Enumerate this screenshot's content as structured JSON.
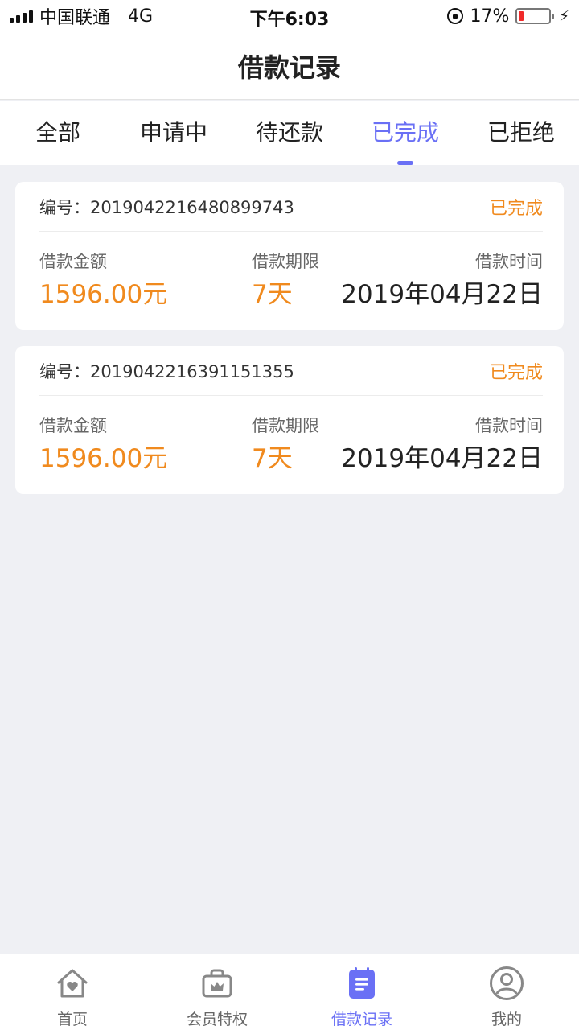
{
  "status_bar": {
    "carrier": "中国联通",
    "network": "4G",
    "time": "下午6:03",
    "battery": "17%",
    "battery_level": 0.17
  },
  "nav": {
    "title": "借款记录"
  },
  "tabs": [
    {
      "label": "全部"
    },
    {
      "label": "申请中"
    },
    {
      "label": "待还款"
    },
    {
      "label": "已完成"
    },
    {
      "label": "已拒绝"
    }
  ],
  "active_tab": "已完成",
  "colors": {
    "accent": "#6a70f5",
    "orange": "#f08a1e",
    "background": "#eff0f4"
  },
  "records": [
    {
      "number_label": "编号：",
      "number": "2019042216480899743",
      "status": "已完成",
      "amount_label": "借款金额",
      "amount": "1596.00元",
      "period_label": "借款期限",
      "period": "7天",
      "time_label": "借款时间",
      "time": "2019年04月22日"
    },
    {
      "number_label": "编号：",
      "number": "2019042216391151355",
      "status": "已完成",
      "amount_label": "借款金额",
      "amount": "1596.00元",
      "period_label": "借款期限",
      "period": "7天",
      "time_label": "借款时间",
      "time": "2019年04月22日"
    }
  ],
  "tabbar": [
    {
      "label": "首页",
      "icon": "home-heart-icon"
    },
    {
      "label": "会员特权",
      "icon": "crown-bag-icon"
    },
    {
      "label": "借款记录",
      "icon": "notepad-icon"
    },
    {
      "label": "我的",
      "icon": "user-circle-icon"
    }
  ]
}
